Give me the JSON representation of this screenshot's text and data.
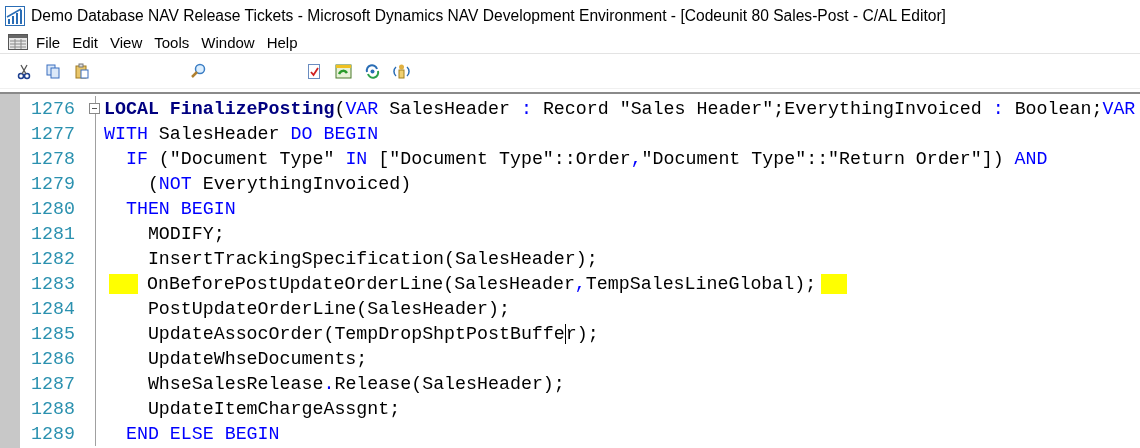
{
  "window": {
    "title": "Demo Database NAV Release Tickets - Microsoft Dynamics NAV Development Environment - [Codeunit 80 Sales-Post - C/AL Editor]"
  },
  "menu": [
    {
      "label": "File"
    },
    {
      "label": "Edit"
    },
    {
      "label": "View"
    },
    {
      "label": "Tools"
    },
    {
      "label": "Window"
    },
    {
      "label": "Help"
    }
  ],
  "toolbar": [
    {
      "kind": "cut"
    },
    {
      "kind": "copy"
    },
    {
      "kind": "paste"
    },
    {
      "kind": "gap"
    },
    {
      "kind": "find"
    },
    {
      "kind": "gap"
    },
    {
      "kind": "compile"
    },
    {
      "kind": "run"
    },
    {
      "kind": "refresh"
    },
    {
      "kind": "symbols"
    }
  ],
  "lines": [
    {
      "number": "1276",
      "foldable": true,
      "tokens": [
        {
          "kind": "decl",
          "text": "LOCAL FinalizePosting"
        },
        {
          "kind": "plain",
          "text": "("
        },
        {
          "kind": "kw",
          "text": "VAR"
        },
        {
          "kind": "plain",
          "text": " SalesHeader "
        },
        {
          "kind": "kw",
          "text": ":"
        },
        {
          "kind": "plain",
          "text": " Record \"Sales Header\";EverythingInvoiced "
        },
        {
          "kind": "kw",
          "text": ":"
        },
        {
          "kind": "plain",
          "text": " Boolean;"
        },
        {
          "kind": "kw",
          "text": "VAR"
        }
      ]
    },
    {
      "number": "1277",
      "foldable": false,
      "tokens": [
        {
          "kind": "kw",
          "text": "WITH"
        },
        {
          "kind": "plain",
          "text": " SalesHeader "
        },
        {
          "kind": "kw",
          "text": "DO BEGIN"
        }
      ]
    },
    {
      "number": "1278",
      "foldable": false,
      "tokens": [
        {
          "kind": "kw",
          "text": "  IF"
        },
        {
          "kind": "plain",
          "text": " (\"Document Type\" "
        },
        {
          "kind": "kw",
          "text": "IN"
        },
        {
          "kind": "plain",
          "text": " [\"Document Type\"::Order"
        },
        {
          "kind": "kw",
          "text": ","
        },
        {
          "kind": "plain",
          "text": "\"Document Type\"::\"Return Order\"]) "
        },
        {
          "kind": "kw",
          "text": "AND"
        }
      ]
    },
    {
      "number": "1279",
      "foldable": false,
      "tokens": [
        {
          "kind": "plain",
          "text": "    ("
        },
        {
          "kind": "kw",
          "text": "NOT"
        },
        {
          "kind": "plain",
          "text": " EverythingInvoiced)"
        }
      ]
    },
    {
      "number": "1280",
      "foldable": false,
      "tokens": [
        {
          "kind": "kw",
          "text": "  THEN BEGIN"
        }
      ]
    },
    {
      "number": "1281",
      "foldable": false,
      "tokens": [
        {
          "kind": "plain",
          "text": "    MODIFY;"
        }
      ]
    },
    {
      "number": "1282",
      "foldable": false,
      "tokens": [
        {
          "kind": "plain",
          "text": "    InsertTrackingSpecification(SalesHeader);"
        }
      ]
    },
    {
      "number": "1283",
      "foldable": false,
      "highlight_before": true,
      "highlight_after": true,
      "tokens": [
        {
          "kind": "plain",
          "text": "OnBeforePostUpdateOrderLine(SalesHeader"
        },
        {
          "kind": "kw",
          "text": ","
        },
        {
          "kind": "plain",
          "text": "TempSalesLineGlobal);"
        }
      ]
    },
    {
      "number": "1284",
      "foldable": false,
      "tokens": [
        {
          "kind": "plain",
          "text": "    PostUpdateOrderLine(SalesHeader);"
        }
      ]
    },
    {
      "number": "1285",
      "foldable": false,
      "tokens": [
        {
          "kind": "plain",
          "text": "    UpdateAssocOrder(TempDropShptPostBuffe"
        },
        {
          "kind": "plain",
          "text": "r);",
          "cursor": true
        }
      ]
    },
    {
      "number": "1286",
      "foldable": false,
      "tokens": [
        {
          "kind": "plain",
          "text": "    UpdateWhseDocuments;"
        }
      ]
    },
    {
      "number": "1287",
      "foldable": false,
      "tokens": [
        {
          "kind": "plain",
          "text": "    WhseSalesRelease"
        },
        {
          "kind": "kw",
          "text": "."
        },
        {
          "kind": "plain",
          "text": "Release(SalesHeader);"
        }
      ]
    },
    {
      "number": "1288",
      "foldable": false,
      "tokens": [
        {
          "kind": "plain",
          "text": "    UpdateItemChargeAssgnt;"
        }
      ]
    },
    {
      "number": "1289",
      "foldable": false,
      "tokens": [
        {
          "kind": "kw",
          "text": "  END ELSE BEGIN"
        }
      ]
    }
  ]
}
